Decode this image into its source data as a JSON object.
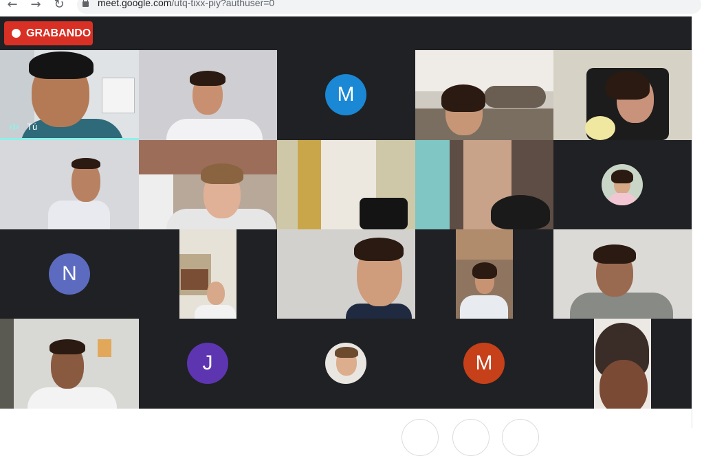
{
  "browser": {
    "back_icon": "arrow-left-icon",
    "forward_icon": "arrow-right-icon",
    "reload_icon": "reload-icon",
    "url_host": "meet.google.com",
    "url_path": "/utq-tixx-piy?authuser=0"
  },
  "recording": {
    "label": "GRABANDO"
  },
  "participants": {
    "self_label": "Tú",
    "tiles": [
      {
        "kind": "video",
        "label": "Tú"
      },
      {
        "kind": "video"
      },
      {
        "kind": "avatar",
        "initial": "M",
        "color": "#1a88d4"
      },
      {
        "kind": "video"
      },
      {
        "kind": "video"
      },
      {
        "kind": "video"
      },
      {
        "kind": "video"
      },
      {
        "kind": "video"
      },
      {
        "kind": "video"
      },
      {
        "kind": "photo-avatar"
      },
      {
        "kind": "avatar",
        "initial": "N",
        "color": "#5c6bc0"
      },
      {
        "kind": "video"
      },
      {
        "kind": "video"
      },
      {
        "kind": "video"
      },
      {
        "kind": "video"
      },
      {
        "kind": "video"
      },
      {
        "kind": "avatar",
        "initial": "J",
        "color": "#5e35b1"
      },
      {
        "kind": "photo-avatar"
      },
      {
        "kind": "avatar",
        "initial": "M",
        "color": "#c6401a"
      },
      {
        "kind": "video"
      }
    ]
  }
}
